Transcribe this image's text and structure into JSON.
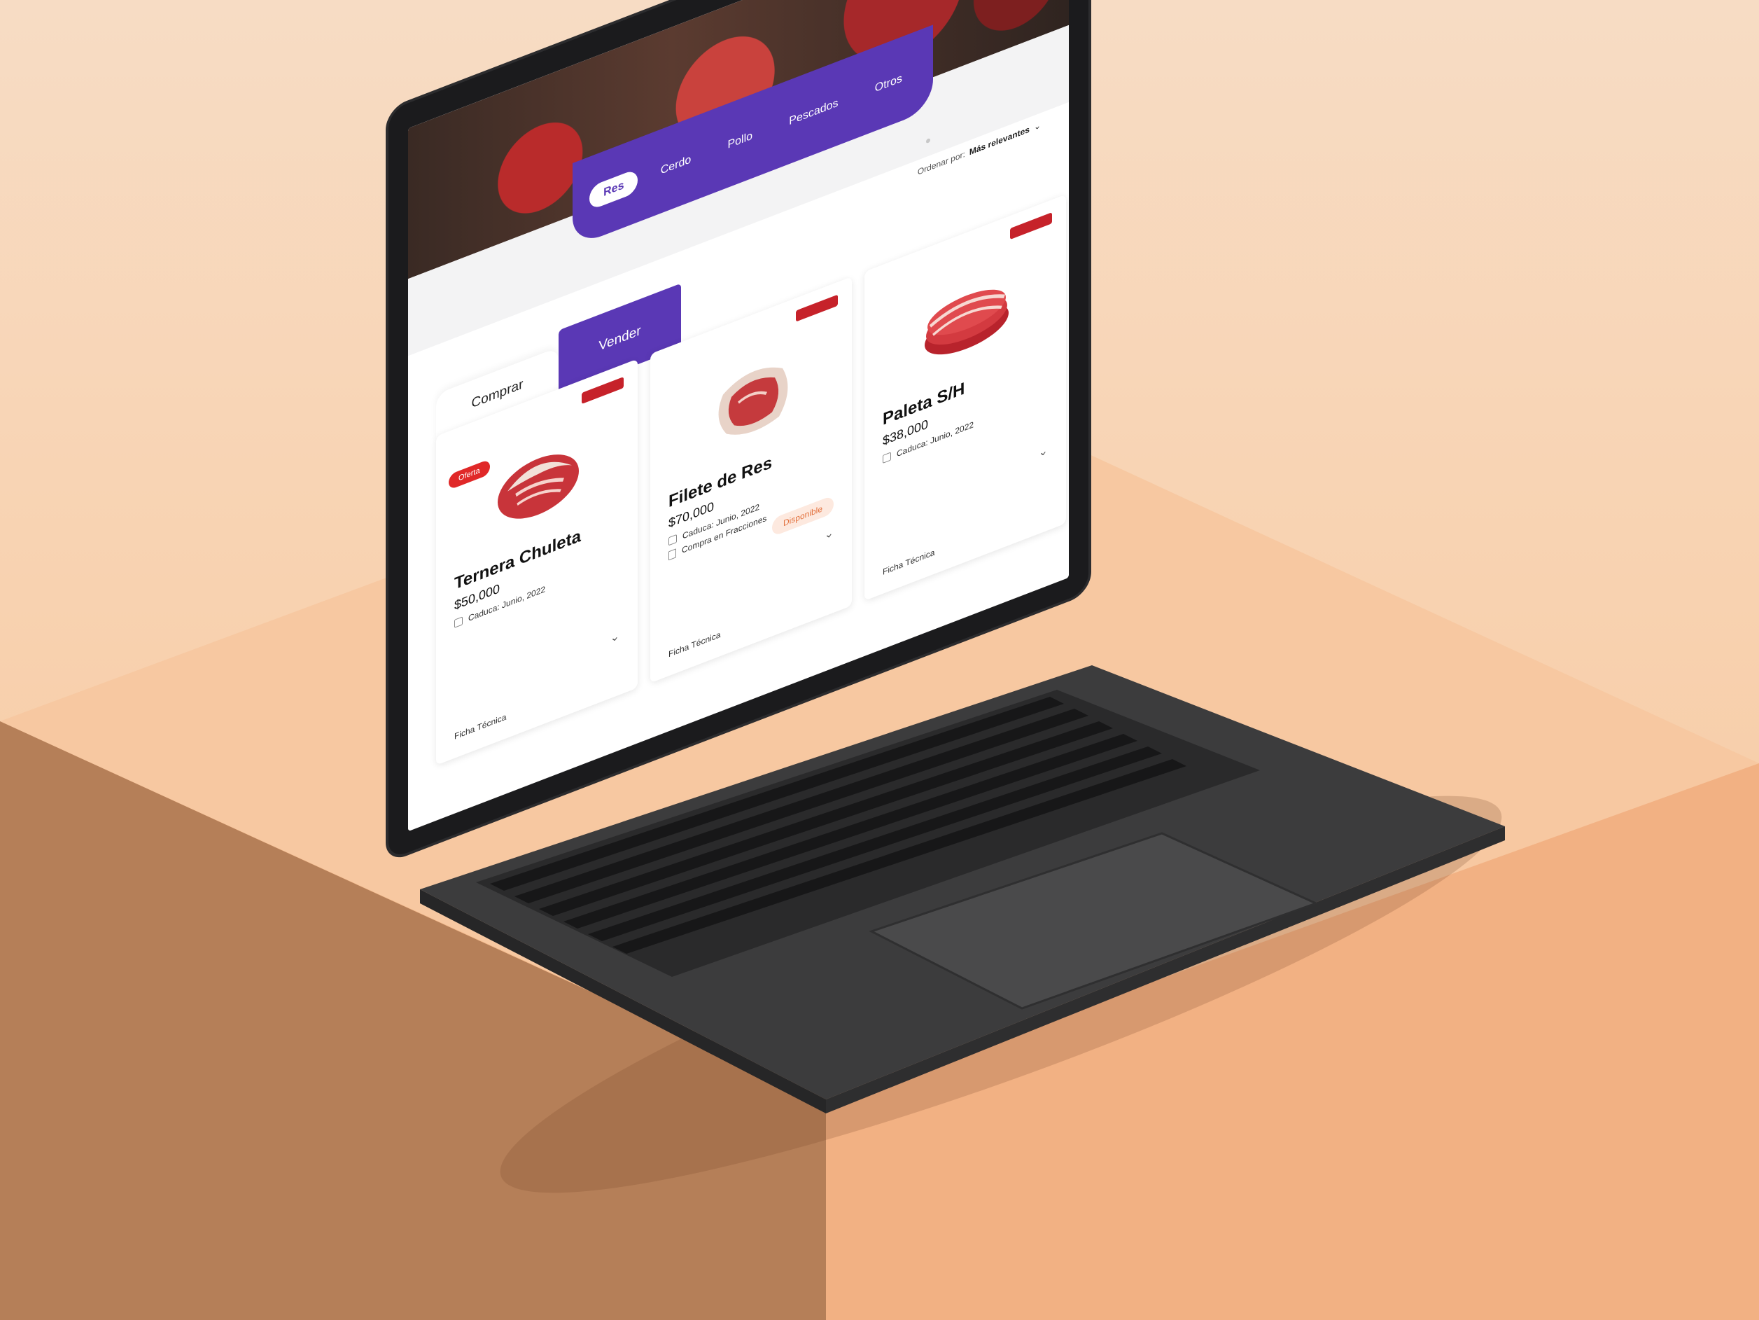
{
  "categories": [
    {
      "label": "Res",
      "active": true
    },
    {
      "label": "Cerdo",
      "active": false
    },
    {
      "label": "Pollo",
      "active": false
    },
    {
      "label": "Pescados",
      "active": false
    },
    {
      "label": "Otros",
      "active": false
    }
  ],
  "sort": {
    "label": "Ordenar por:",
    "value": "Más relevantes"
  },
  "tabs": {
    "buy": "Comprar",
    "sell": "Vender"
  },
  "products": [
    {
      "name": "Ternera Chuleta",
      "price": "$50,000",
      "expiry": "Caduca: Junio, 2022",
      "badge": "Oferta",
      "spec": "Ficha Técnica"
    },
    {
      "name": "Filete de Res",
      "price": "$70,000",
      "expiry": "Caduca: Junio, 2022",
      "fractions": "Compra en Fracciones",
      "status": "Disponible",
      "spec": "Ficha Técnica"
    },
    {
      "name": "Paleta S/H",
      "price": "$38,000",
      "expiry": "Caduca: Junio, 2022",
      "spec": "Ficha Técnica"
    }
  ],
  "colors": {
    "accent": "#5a38b5",
    "offer": "#e02828",
    "status_bg": "#fde9df",
    "status_text": "#e2703c",
    "laptop": "#1b1b1d",
    "pedestal_top": "#f7c49c",
    "pedestal_left": "#b57f58"
  },
  "icons": [
    "calendar-icon",
    "document-icon",
    "chevron-down-icon",
    "brand-logo-icon"
  ]
}
